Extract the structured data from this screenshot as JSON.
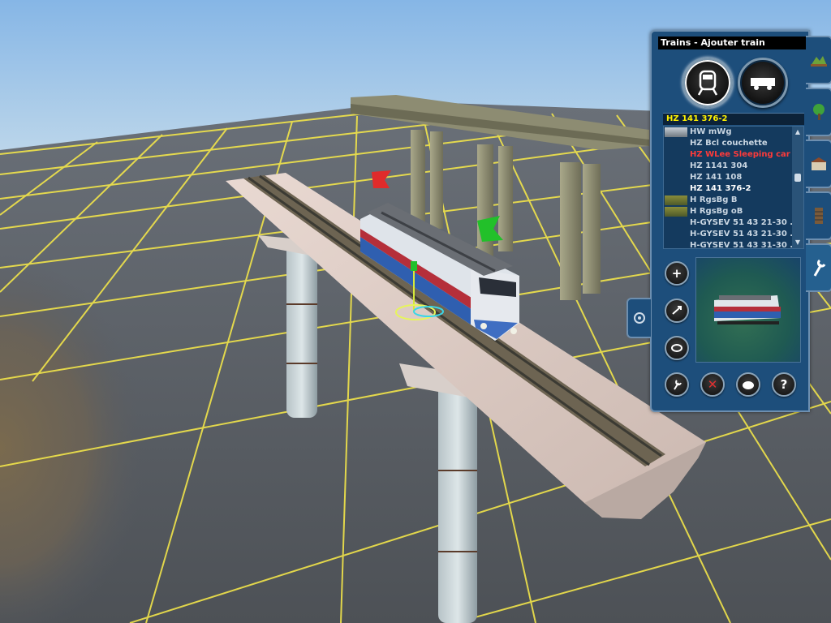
{
  "panel": {
    "title": "Trains - Ajouter train",
    "selected_name": "HZ 141 376-2",
    "items": [
      {
        "label": "HW mWg",
        "state": "normal"
      },
      {
        "label": "HZ Bcl couchette",
        "state": "normal"
      },
      {
        "label": "HZ WLee Sleeping car",
        "state": "red"
      },
      {
        "label": "HZ 1141 304",
        "state": "normal"
      },
      {
        "label": "HZ 141 108",
        "state": "normal"
      },
      {
        "label": "HZ 141 376-2",
        "state": "selected"
      },
      {
        "label": "H RgsBg B",
        "state": "normal"
      },
      {
        "label": "H RgsBg oB",
        "state": "normal"
      },
      {
        "label": "H-GYSEV 51 43 21-30 ...",
        "state": "normal"
      },
      {
        "label": "H-GYSEV 51 43 21-30 ...",
        "state": "normal"
      },
      {
        "label": "H-GYSEV 51 43 31-30 ...",
        "state": "normal"
      }
    ],
    "mode_buttons": [
      {
        "icon": "locomotive-icon",
        "active": true
      },
      {
        "icon": "wagon-icon",
        "active": false
      }
    ],
    "tools": [
      "add-icon",
      "rotate-icon",
      "flip-icon",
      "wrench-icon",
      "delete-icon",
      "cargo-icon",
      "help-icon"
    ],
    "side_tabs": [
      "terrain-icon",
      "tree-icon",
      "building-icon",
      "track-icon",
      "settings-wrench-icon"
    ],
    "help_glyph": "?"
  },
  "colors": {
    "panel_bg": "#1d4e7b",
    "selected_text": "#fff200",
    "highlight_red": "#ff3a3a",
    "grid_line": "#f2e54a",
    "ground": "#585c62",
    "sky": "#9cc3e8"
  }
}
